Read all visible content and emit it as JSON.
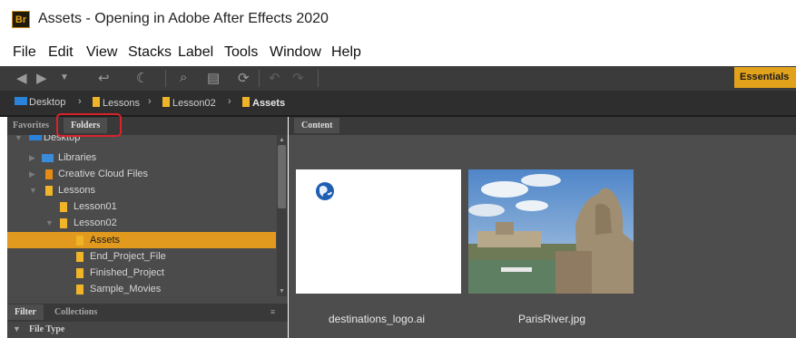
{
  "window": {
    "badge": "Br",
    "title": "Assets - Opening in Adobe After Effects 2020"
  },
  "menu": [
    "File",
    "Edit",
    "View",
    "Stacks",
    "Label",
    "Tools",
    "Window",
    "Help"
  ],
  "toolbar": {
    "icons": [
      "back-arrow-icon",
      "forward-arrow-icon",
      "history-dropdown-icon",
      "boomerang-icon",
      "rotate-icon",
      "camera-download-icon",
      "refine-icon",
      "open-recent-icon",
      "rotate-left-icon",
      "rotate-right-icon"
    ],
    "workspace_label": "Essentials"
  },
  "path": [
    "Desktop",
    "Lessons",
    "Lesson02",
    "Assets"
  ],
  "left_tabs": {
    "favorites": "Favorites",
    "folders": "Folders"
  },
  "tree": [
    {
      "label": "Desktop",
      "icon": "desktop-icon"
    },
    {
      "label": "Libraries",
      "icon": "libraries-icon"
    },
    {
      "label": "Creative Cloud Files",
      "icon": "folder-icon"
    },
    {
      "label": "Lessons",
      "icon": "folder-icon"
    },
    {
      "label": "Lesson01",
      "icon": "folder-icon"
    },
    {
      "label": "Lesson02",
      "icon": "folder-icon"
    },
    {
      "label": "Assets",
      "icon": "folder-icon",
      "selected": true
    },
    {
      "label": "End_Project_File",
      "icon": "folder-icon"
    },
    {
      "label": "Finished_Project",
      "icon": "folder-icon"
    },
    {
      "label": "Sample_Movies",
      "icon": "folder-icon"
    }
  ],
  "bottom_tabs": {
    "filter": "Filter",
    "collections": "Collections"
  },
  "filter_heading": "File Type",
  "content_tab": "Content",
  "thumbnails": [
    {
      "name": "destinations_logo.ai"
    },
    {
      "name": "ParisRiver.jpg"
    }
  ],
  "colors": {
    "accent": "#E19A1E",
    "highlight_ring": "#D8232A",
    "panel": "#4B4B4B"
  }
}
